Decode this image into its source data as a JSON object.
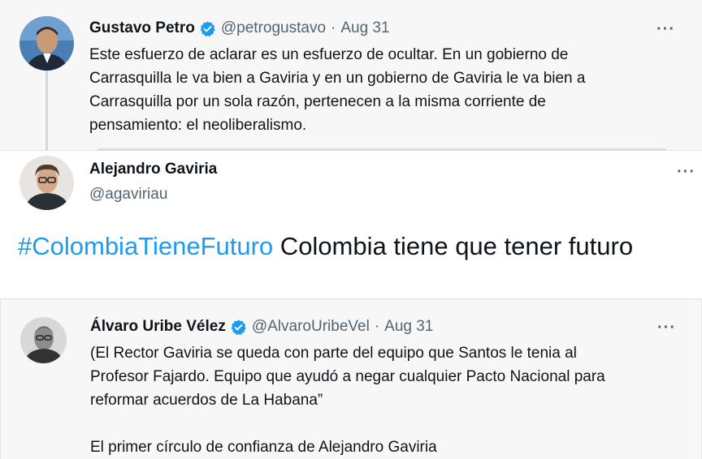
{
  "tweet1": {
    "name": "Gustavo Petro",
    "handle": "@petrogustavo",
    "separator": "·",
    "date": "Aug 31",
    "more": "···",
    "text": "Este esfuerzo de aclarar es un esfuerzo de ocultar. En un gobierno de\nCarrasquilla le va bien a Gaviria y en un gobierno de Gaviria le va bien a\nCarrasquilla por un sola razón, pertenecen a la misma corriente de\npensamiento: el neoliberalismo."
  },
  "tweet2": {
    "name": "Alejandro Gaviria",
    "handle": "@agaviriau",
    "more": "···",
    "hashtag": "#ColombiaTieneFuturo",
    "text": " Colombia tiene que tener futuro"
  },
  "tweet3": {
    "name": "Álvaro Uribe Vélez",
    "handle": "@AlvaroUribeVel",
    "separator": "·",
    "date": "Aug 31",
    "more": "···",
    "text": "(El Rector Gaviria se queda con parte del equipo que Santos le tenia al\nProfesor Fajardo. Equipo que ayudó a negar cualquier Pacto Nacional para\nreformar acuerdos de La Habana”\n\nEl primer círculo de confianza de Alejandro Gaviria"
  },
  "icons": {
    "verified": "verified-badge-icon",
    "more": "more-options-icon"
  },
  "colors": {
    "link": "#1d9bf0",
    "verified": "#1d9bf0",
    "secondary_text": "#536471",
    "primary_text": "#0f1419",
    "quoted_bg": "#f7f7f7"
  }
}
